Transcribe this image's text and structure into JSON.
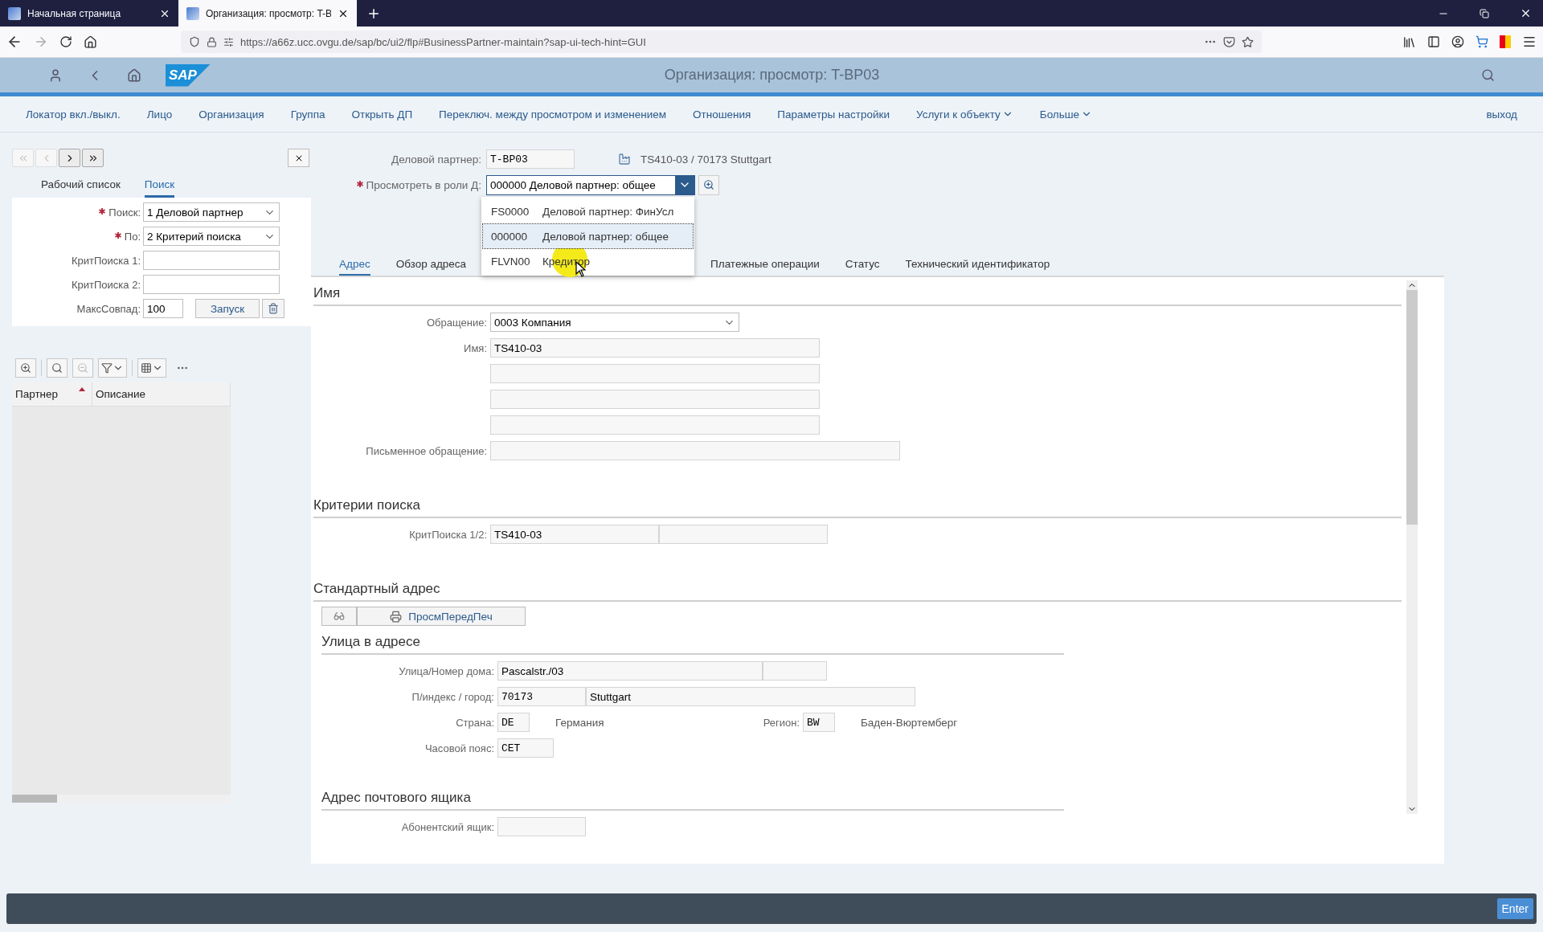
{
  "browser": {
    "tabs": [
      {
        "title": "Начальная страница",
        "selected": false
      },
      {
        "title": "Организация: просмотр: T-B",
        "selected": true
      }
    ],
    "url": "https://a66z.ucc.ovgu.de/sap/bc/ui2/flp#BusinessPartner-maintain?sap-ui-tech-hint=GUI"
  },
  "shell": {
    "logo": "SAP",
    "title": "Организация: просмотр: T-BP03"
  },
  "menu": {
    "items": [
      {
        "label": "Локатор вкл./выкл.",
        "dropdown": false
      },
      {
        "label": "Лицо",
        "dropdown": false
      },
      {
        "label": "Организация",
        "dropdown": false
      },
      {
        "label": "Группа",
        "dropdown": false
      },
      {
        "label": "Открыть ДП",
        "dropdown": false
      },
      {
        "label": "Переключ. между просмотром и изменением",
        "dropdown": false
      },
      {
        "label": "Отношения",
        "dropdown": false
      },
      {
        "label": "Параметры настройки",
        "dropdown": false
      },
      {
        "label": "Услуги к объекту",
        "dropdown": true
      },
      {
        "label": "Больше",
        "dropdown": true
      }
    ],
    "logout": "выход"
  },
  "left_panel": {
    "nav_buttons": [
      {
        "kind": "first",
        "disabled": true
      },
      {
        "kind": "prev",
        "disabled": true
      },
      {
        "kind": "next",
        "disabled": false
      },
      {
        "kind": "last",
        "disabled": false
      }
    ],
    "tabs": [
      {
        "label": "Рабочий список",
        "selected": false
      },
      {
        "label": "Поиск",
        "selected": true
      }
    ],
    "fields": [
      {
        "label": "Поиск:",
        "required": true,
        "kind": "select",
        "value": "1 Деловой партнер"
      },
      {
        "label": "По:",
        "required": true,
        "kind": "select",
        "value": "2 Критерий поиска"
      },
      {
        "label": "КритПоиска 1:",
        "required": false,
        "kind": "input"
      },
      {
        "label": "КритПоиска 2:",
        "required": false,
        "kind": "input"
      }
    ],
    "max_hits": {
      "label": "МаксСовпад:",
      "value": "100"
    },
    "run_button": "Запуск",
    "table": {
      "columns": [
        {
          "label": "Партнер",
          "sorted": true
        },
        {
          "label": "Описание",
          "sorted": false
        }
      ]
    }
  },
  "header": {
    "partner": {
      "label": "Деловой партнер:",
      "value": "T-BP03",
      "description": "TS410-03 / 70173 Stuttgart"
    },
    "role": {
      "label": "Просмотреть в роли Д:",
      "required": true,
      "value": "000000 Деловой партнер: общее",
      "options": [
        {
          "code": "FS0000",
          "label": "Деловой партнер: ФинУсл",
          "selected": false
        },
        {
          "code": "000000",
          "label": "Деловой партнер: общее",
          "selected": true
        },
        {
          "code": "FLVN00",
          "label": "Кредитор",
          "selected": false
        }
      ]
    }
  },
  "tabs": [
    {
      "label": "Адрес",
      "selected": true
    },
    {
      "label": "Обзор адреса",
      "selected": false
    },
    {
      "label": "Платежные операции",
      "selected": false
    },
    {
      "label": "Статус",
      "selected": false
    },
    {
      "label": "Технический идентификатор",
      "selected": false
    }
  ],
  "name_section": {
    "title": "Имя",
    "salutation": {
      "label": "Обращение:",
      "value": "0003 Компания"
    },
    "name": {
      "label": "Имя:",
      "value": "TS410-03"
    },
    "letter_salutation": {
      "label": "Письменное обращение:"
    }
  },
  "search_section": {
    "title": "Критерии поиска",
    "label": "КритПоиска 1/2:",
    "value": "TS410-03"
  },
  "address_section": {
    "title": "Стандартный адрес",
    "print_button": "ПросмПередПеч",
    "street_block": {
      "title": "Улица в адресе",
      "street": {
        "label": "Улица/Номер дома:",
        "value": "Pascalstr./03"
      },
      "postal": {
        "label": "П/индекс / город:",
        "code": "70173",
        "city": "Stuttgart"
      },
      "country": {
        "label": "Страна:",
        "code": "DE",
        "name": "Германия"
      },
      "region": {
        "label": "Регион:",
        "code": "BW",
        "name": "Баден-Вюртемберг"
      },
      "timezone": {
        "label": "Часовой пояс:",
        "value": "CET"
      }
    },
    "po_box": {
      "title": "Адрес почтового ящика",
      "label": "Абонентский ящик:"
    }
  },
  "footer": {
    "enter_button": "Enter"
  }
}
